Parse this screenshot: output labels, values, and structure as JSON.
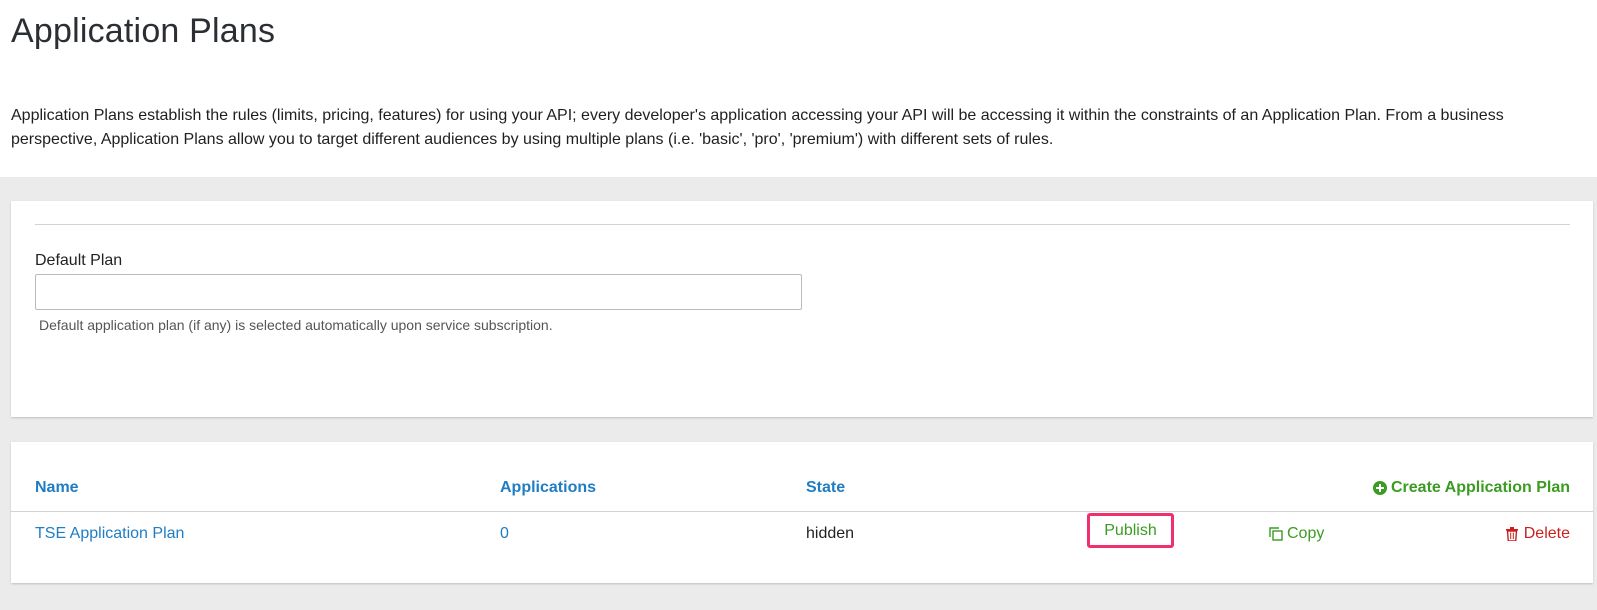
{
  "header": {
    "title": "Application Plans",
    "description": "Application Plans establish the rules (limits, pricing, features) for using your API; every developer's application accessing your API will be accessing it within the constraints of an Application Plan. From a business perspective, Application Plans allow you to target different audiences by using multiple plans (i.e. 'basic', 'pro', 'premium') with different sets of rules."
  },
  "default_plan": {
    "label": "Default Plan",
    "value": "",
    "help": "Default application plan (if any) is selected automatically upon service subscription."
  },
  "table": {
    "columns": [
      "Name",
      "Applications",
      "State"
    ],
    "create_label": "Create Application Plan",
    "rows": [
      {
        "name": "TSE Application Plan",
        "applications": "0",
        "state": "hidden",
        "publish_label": "Publish",
        "copy_label": "Copy",
        "delete_label": "Delete"
      }
    ]
  },
  "colors": {
    "link_blue": "#1f7dc4",
    "action_green": "#3b9b23",
    "delete_red": "#cc1f1f",
    "highlight_pink": "#f0306d"
  },
  "icons": {
    "create": "plus-circle-icon",
    "copy": "copy-icon",
    "delete": "trash-icon"
  }
}
